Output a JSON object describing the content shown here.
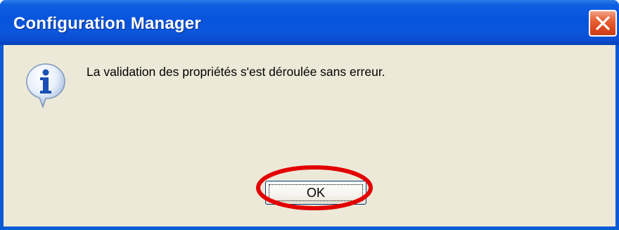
{
  "window": {
    "title": "Configuration Manager",
    "close_icon": "close-x-icon"
  },
  "dialog": {
    "icon": "information-icon",
    "message": "La validation des propriétés s'est déroulée sans erreur.",
    "ok_label": "OK"
  },
  "annotation": {
    "highlight": "red-ellipse",
    "color": "#e30000"
  },
  "colors": {
    "titlebar": "#0855dd",
    "client_background": "#ece9d8",
    "close_button": "#dd4a20"
  }
}
